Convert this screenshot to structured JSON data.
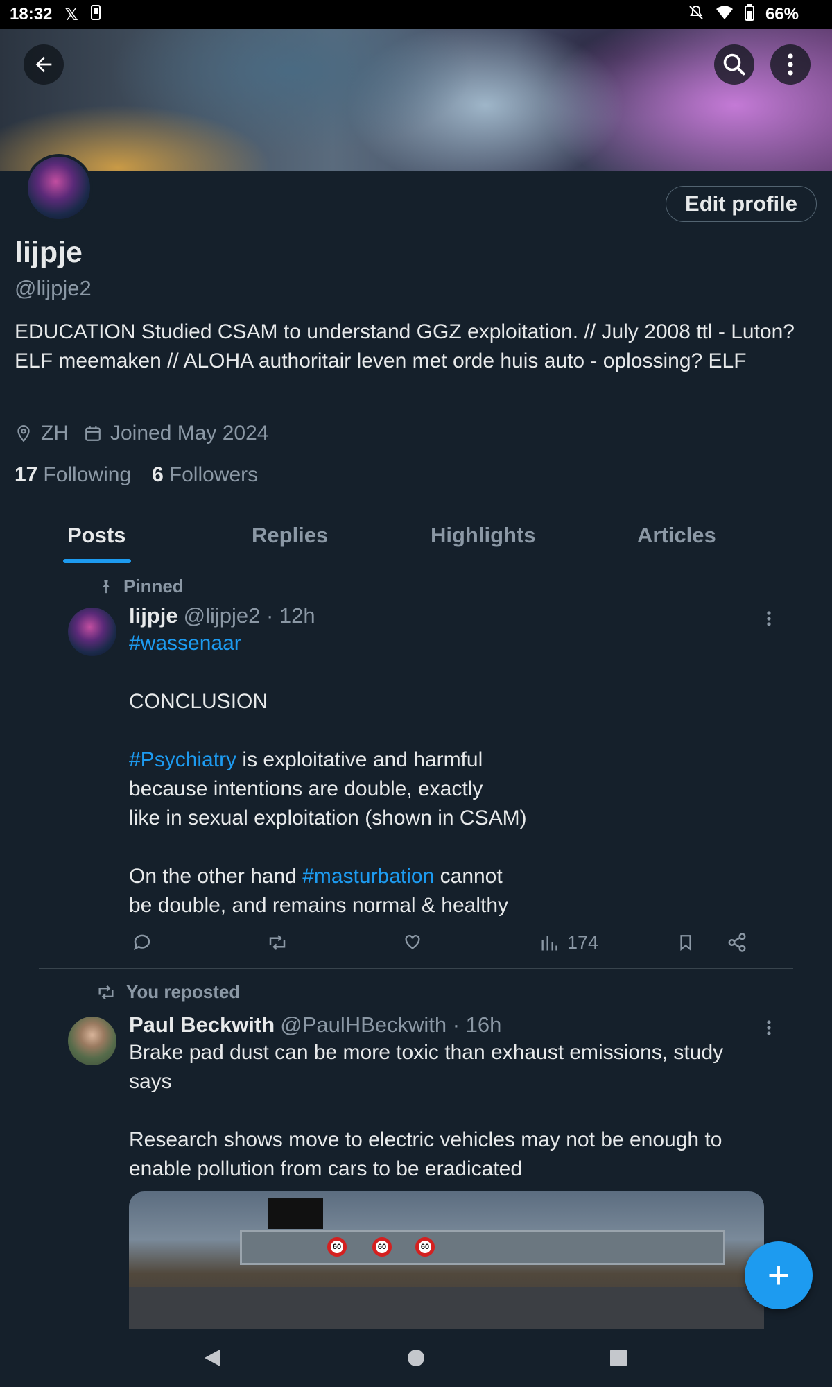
{
  "status_bar": {
    "time": "18:32",
    "battery": "66%",
    "icons": [
      "x-logo-icon",
      "sim-icon",
      "mute-icon",
      "wifi-icon",
      "battery-icon"
    ]
  },
  "header": {
    "back_icon": "arrow-left-icon",
    "search_icon": "search-icon",
    "more_icon": "more-vertical-icon"
  },
  "profile": {
    "edit_label": "Edit profile",
    "name": "lijpje",
    "handle": "@lijpje2",
    "bio": "EDUCATION Studied CSAM to understand GGZ exploitation. // July 2008 ttl - Luton? ELF meemaken // ALOHA authoritair leven met orde huis auto - oplossing? ELF",
    "location": "ZH",
    "joined": "Joined May 2024",
    "following_count": "17",
    "following_label": "Following",
    "followers_count": "6",
    "followers_label": "Followers"
  },
  "tabs": [
    {
      "label": "Posts"
    },
    {
      "label": "Replies"
    },
    {
      "label": "Highlights"
    },
    {
      "label": "Articles"
    }
  ],
  "tweet1": {
    "context": "Pinned",
    "name": "lijpje",
    "handle_time": "@lijpje2 · 12h",
    "hashtag1": "#wassenaar",
    "line_conclusion": "CONCLUSION",
    "hashtag2": "#Psychiatry",
    "text_a": " is exploitative and harmful",
    "text_b": "because intentions are double, exactly",
    "text_c": "like in sexual exploitation (shown in CSAM)",
    "text_d": "On the other hand ",
    "hashtag3": "#masturbation",
    "text_e": " cannot",
    "text_f": "be double, and remains normal & healthy",
    "views": "174"
  },
  "tweet2": {
    "context": "You reposted",
    "name": "Paul Beckwith",
    "handle_time": "@PaulHBeckwith · 16h",
    "text": "Brake pad dust can be more toxic than exhaust emissions, study says\n\nResearch shows move to electric vehicles may not be enough to enable pollution from cars to be eradicated",
    "media_signs": [
      "60",
      "60",
      "60"
    ]
  },
  "colors": {
    "background": "#15202b",
    "accent": "#1d9bf0",
    "muted_text": "#8b98a5",
    "divider": "#38444d"
  }
}
